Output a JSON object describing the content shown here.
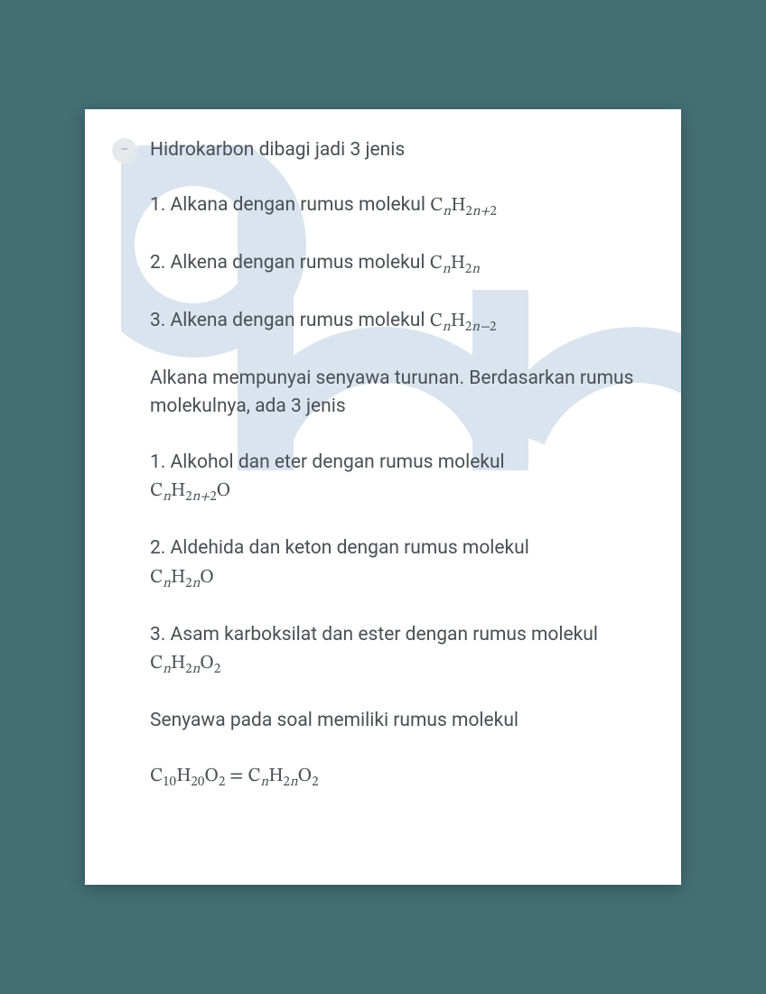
{
  "intro": "Hidrokarbon dibagi jadi 3 jenis",
  "hydro_items": [
    {
      "prefix": "1. Alkana dengan rumus molekul ",
      "formula_html": "C<sub>n</sub>H<sub><span class='num'>2</span>n+<span class='num'>2</span></sub>"
    },
    {
      "prefix": "2. Alkena dengan rumus molekul ",
      "formula_html": "C<sub>n</sub>H<sub><span class='num'>2</span>n</sub>"
    },
    {
      "prefix": "3. Alkena dengan rumus molekul ",
      "formula_html": "C<sub>n</sub>H<sub><span class='num'>2</span>n−<span class='num'>2</span></sub>"
    }
  ],
  "middle": "Alkana mempunyai senyawa turunan. Berdasarkan rumus molekulnya, ada 3 jenis",
  "deriv_items": [
    {
      "prefix": "1. Alkohol dan eter dengan rumus molekul ",
      "formula_html": "C<sub>n</sub>H<sub><span class='num'>2</span>n+<span class='num'>2</span></sub>O"
    },
    {
      "prefix": "2. Aldehida dan keton dengan rumus molekul ",
      "formula_html": "C<sub>n</sub>H<sub><span class='num'>2</span>n</sub>O"
    },
    {
      "prefix": "3. Asam karboksilat dan ester dengan rumus molekul ",
      "formula_html": "C<sub>n</sub>H<sub><span class='num'>2</span>n</sub>O<sub><span class='num'>2</span></sub>"
    }
  ],
  "closing": "Senyawa pada soal memiliki rumus molekul",
  "final_formula_html": "C<sub><span class='num'>10</span></sub>H<sub><span class='num'>20</span></sub>O<sub><span class='num'>2</span></sub> = C<sub>n</sub>H<sub><span class='num'>2</span>n</sub>O<sub><span class='num'>2</span></sub>",
  "watermark_text": "aha",
  "bullet_char": "–"
}
